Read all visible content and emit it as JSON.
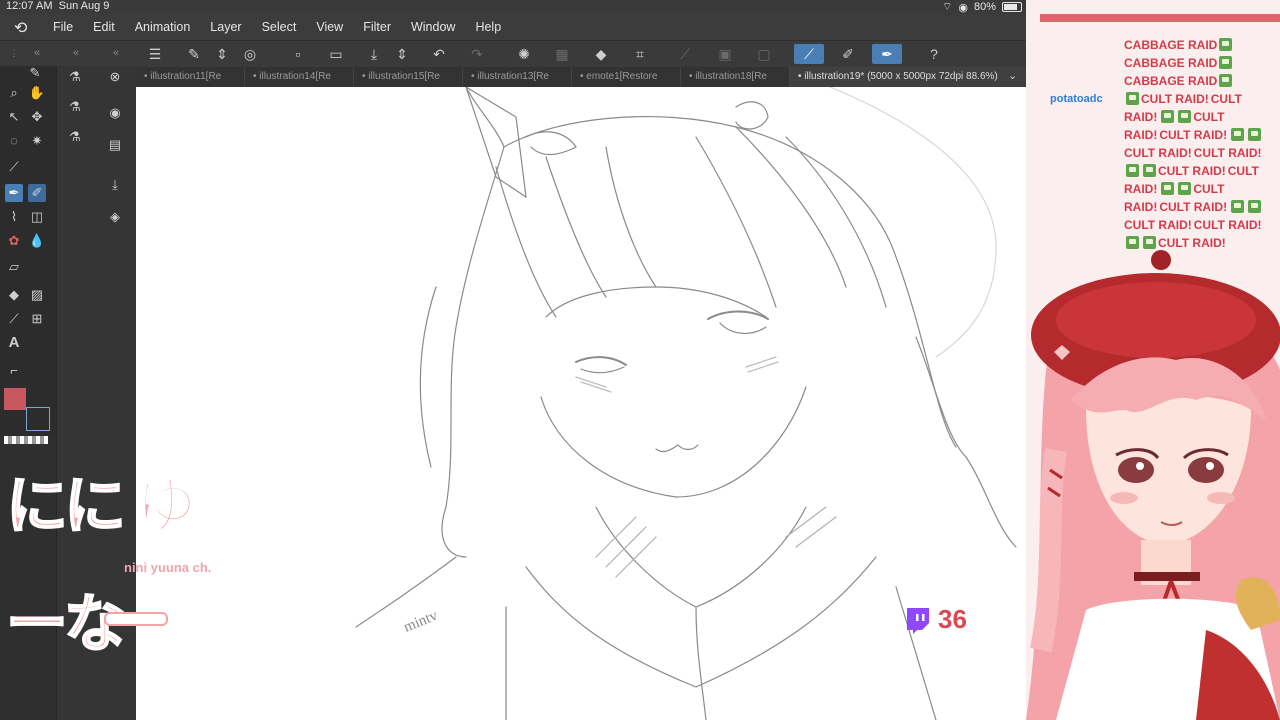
{
  "status_bar": {
    "time": "12:07 AM",
    "date": "Sun Aug 9",
    "battery": "80%",
    "battery_level": 0.8
  },
  "menu": {
    "items": [
      "File",
      "Edit",
      "Animation",
      "Layer",
      "Select",
      "View",
      "Filter",
      "Window",
      "Help"
    ]
  },
  "tabs": [
    {
      "label": "illustration11[Re"
    },
    {
      "label": "illustration14[Re"
    },
    {
      "label": "illustration15[Re"
    },
    {
      "label": "illustration13[Re"
    },
    {
      "label": "emote1[Restore"
    },
    {
      "label": "illustration18[Re"
    },
    {
      "label": "illustration19* (5000 x 5000px 72dpi 88.6%)",
      "active": true
    }
  ],
  "canvas": {
    "signature": "mintv"
  },
  "twitch_counter": {
    "value": "36"
  },
  "chat": {
    "lines": [
      {
        "text": "CABBAGE RAID"
      },
      {
        "text": "CABBAGE RAID"
      },
      {
        "text": "CABBAGE RAID"
      }
    ],
    "user": "potatoadc",
    "raid_text": "CULT RAID!"
  },
  "logo": {
    "main": "にに ゆーな",
    "sub": "nini yuuna ch."
  },
  "colors": {
    "accent": "#4a7fb5",
    "chat_text": "#d23c4a",
    "username": "#2f7fd6",
    "primary_swatch": "#c8585f",
    "counter": "#d84b55",
    "twitch_purple": "#9146ff"
  }
}
